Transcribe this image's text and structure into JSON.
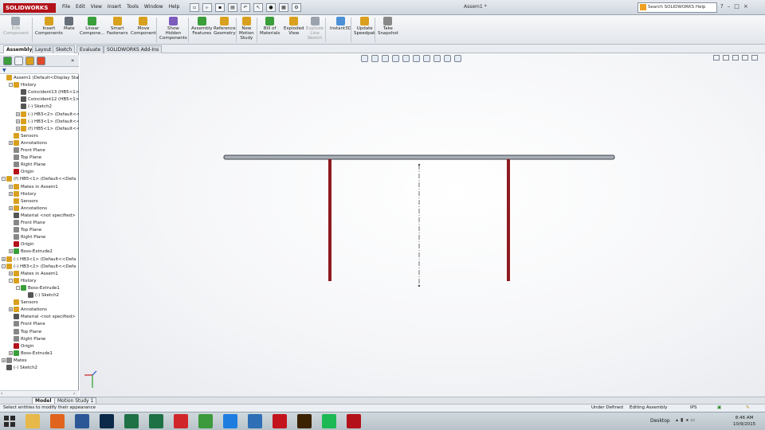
{
  "app": {
    "logo_text": "SOLIDWORKS",
    "document_title": "Assem1 *",
    "menus": [
      "File",
      "Edit",
      "View",
      "Insert",
      "Tools",
      "Window",
      "Help"
    ],
    "help_search_placeholder": "Search SOLIDWORKS Help"
  },
  "command_manager": [
    {
      "label": "Edit\nComponent",
      "disabled": true,
      "color": "#9aa3ad"
    },
    {
      "label": "Insert\nComponents",
      "disabled": false,
      "color": "#d9a01e"
    },
    {
      "label": "Mate",
      "disabled": false,
      "color": "#666e78"
    },
    {
      "label": "Linear\nCompone...",
      "disabled": false,
      "color": "#3a9e3a"
    },
    {
      "label": "Smart\nFasteners",
      "disabled": false,
      "color": "#d9a01e"
    },
    {
      "label": "Move\nComponent",
      "disabled": false,
      "color": "#d9a01e"
    },
    {
      "label": "Show\nHidden\nComponents",
      "disabled": false,
      "color": "#7d5bbd"
    },
    {
      "label": "Assembly\nFeatures",
      "disabled": false,
      "color": "#3a9e3a"
    },
    {
      "label": "Reference\nGeometry",
      "disabled": false,
      "color": "#d9a01e"
    },
    {
      "label": "New\nMotion\nStudy",
      "disabled": false,
      "color": "#d9a01e"
    },
    {
      "label": "Bill of\nMaterials",
      "disabled": false,
      "color": "#3a9e3a"
    },
    {
      "label": "Exploded\nView",
      "disabled": false,
      "color": "#d9a01e"
    },
    {
      "label": "Explode\nLine\nSketch",
      "disabled": true,
      "color": "#9aa3ad"
    },
    {
      "label": "Instant3D",
      "disabled": false,
      "color": "#4c8fd6"
    },
    {
      "label": "Update\nSpeedpak",
      "disabled": false,
      "color": "#d9a01e"
    },
    {
      "label": "Take\nSnapshot",
      "disabled": false,
      "color": "#888"
    }
  ],
  "tabs": [
    "Assembly",
    "Layout",
    "Sketch",
    "Evaluate",
    "SOLIDWORKS Add-Ins"
  ],
  "active_tab": "Assembly",
  "tree": [
    {
      "d": 0,
      "t": "Assem1  (Default<Display State",
      "c": "#d9a01e",
      "e": ""
    },
    {
      "d": 1,
      "t": "History",
      "c": "#d9a01e",
      "e": "-"
    },
    {
      "d": 2,
      "t": "Coincident13 (HB5<1>,H",
      "c": "#555",
      "e": ""
    },
    {
      "d": 2,
      "t": "Coincident12 (HB5<1>,H",
      "c": "#555",
      "e": ""
    },
    {
      "d": 2,
      "t": "(-) Sketch2",
      "c": "#555",
      "e": ""
    },
    {
      "d": 2,
      "t": "(-) HB3<2> (Default<<D",
      "c": "#d9a01e",
      "e": "+"
    },
    {
      "d": 2,
      "t": "(-) HB3<1> (Default<<D",
      "c": "#d9a01e",
      "e": "+"
    },
    {
      "d": 2,
      "t": "(f) HB5<1> (Default<<D",
      "c": "#d9a01e",
      "e": "+"
    },
    {
      "d": 1,
      "t": "Sensors",
      "c": "#d9a01e",
      "e": ""
    },
    {
      "d": 1,
      "t": "Annotations",
      "c": "#d9a01e",
      "e": "+"
    },
    {
      "d": 1,
      "t": "Front Plane",
      "c": "#888",
      "e": ""
    },
    {
      "d": 1,
      "t": "Top Plane",
      "c": "#888",
      "e": ""
    },
    {
      "d": 1,
      "t": "Right Plane",
      "c": "#888",
      "e": ""
    },
    {
      "d": 1,
      "t": "Origin",
      "c": "#b3121a",
      "e": ""
    },
    {
      "d": 0,
      "t": "(f) HB5<1> (Default<<Defa",
      "c": "#d9a01e",
      "e": "-"
    },
    {
      "d": 1,
      "t": "Mates in Assem1",
      "c": "#d9a01e",
      "e": "+"
    },
    {
      "d": 1,
      "t": "History",
      "c": "#d9a01e",
      "e": "+"
    },
    {
      "d": 1,
      "t": "Sensors",
      "c": "#d9a01e",
      "e": ""
    },
    {
      "d": 1,
      "t": "Annotations",
      "c": "#d9a01e",
      "e": "+"
    },
    {
      "d": 1,
      "t": "Material <not specified>",
      "c": "#555",
      "e": ""
    },
    {
      "d": 1,
      "t": "Front Plane",
      "c": "#888",
      "e": ""
    },
    {
      "d": 1,
      "t": "Top Plane",
      "c": "#888",
      "e": ""
    },
    {
      "d": 1,
      "t": "Right Plane",
      "c": "#888",
      "e": ""
    },
    {
      "d": 1,
      "t": "Origin",
      "c": "#b3121a",
      "e": ""
    },
    {
      "d": 1,
      "t": "Boss-Extrude2",
      "c": "#3a9e3a",
      "e": "+"
    },
    {
      "d": 0,
      "t": "(-) HB3<1> (Default<<Defa",
      "c": "#d9a01e",
      "e": "+"
    },
    {
      "d": 0,
      "t": "(-) HB3<2> (Default<<Defa",
      "c": "#d9a01e",
      "e": "-"
    },
    {
      "d": 1,
      "t": "Mates in Assem1",
      "c": "#d9a01e",
      "e": "+"
    },
    {
      "d": 1,
      "t": "History",
      "c": "#d9a01e",
      "e": "-"
    },
    {
      "d": 2,
      "t": "Boss-Extrude1",
      "c": "#3a9e3a",
      "e": "-"
    },
    {
      "d": 3,
      "t": "(-) Sketch2",
      "c": "#555",
      "e": ""
    },
    {
      "d": 1,
      "t": "Sensors",
      "c": "#d9a01e",
      "e": ""
    },
    {
      "d": 1,
      "t": "Annotations",
      "c": "#d9a01e",
      "e": "+"
    },
    {
      "d": 1,
      "t": "Material <not specified>",
      "c": "#555",
      "e": ""
    },
    {
      "d": 1,
      "t": "Front Plane",
      "c": "#888",
      "e": ""
    },
    {
      "d": 1,
      "t": "Top Plane",
      "c": "#888",
      "e": ""
    },
    {
      "d": 1,
      "t": "Right Plane",
      "c": "#888",
      "e": ""
    },
    {
      "d": 1,
      "t": "Origin",
      "c": "#b3121a",
      "e": ""
    },
    {
      "d": 1,
      "t": "Boss-Extrude1",
      "c": "#3a9e3a",
      "e": "+"
    },
    {
      "d": 0,
      "t": "Mates",
      "c": "#888",
      "e": "+"
    },
    {
      "d": 0,
      "t": "(-) Sketch2",
      "c": "#555",
      "e": ""
    }
  ],
  "bottom_tabs": [
    "Model",
    "Motion Study 1"
  ],
  "active_bottom_tab": "Model",
  "status": {
    "message": "Select entities to modify their appearance",
    "state": "Under Defined",
    "mode": "Editing Assembly",
    "units": "IPS"
  },
  "taskbar": {
    "desktop_label": "Desktop",
    "time": "8:46 AM",
    "date": "10/9/2015",
    "apps": [
      {
        "name": "file-explorer",
        "color": "#e7b84a"
      },
      {
        "name": "firefox",
        "color": "#e0641e"
      },
      {
        "name": "word",
        "color": "#2b5797"
      },
      {
        "name": "photoshop",
        "color": "#0b2a4a"
      },
      {
        "name": "excel-green",
        "color": "#1e7145"
      },
      {
        "name": "excel",
        "color": "#1e7145"
      },
      {
        "name": "creative-cloud",
        "color": "#d0262a"
      },
      {
        "name": "chrome",
        "color": "#3c9a3c"
      },
      {
        "name": "dropbox",
        "color": "#1f7de0"
      },
      {
        "name": "app-blue",
        "color": "#2e6fb5"
      },
      {
        "name": "acrobat",
        "color": "#c3141e"
      },
      {
        "name": "illustrator",
        "color": "#3b2200"
      },
      {
        "name": "spotify",
        "color": "#1db954"
      },
      {
        "name": "solidworks",
        "color": "#b3121a"
      }
    ]
  }
}
